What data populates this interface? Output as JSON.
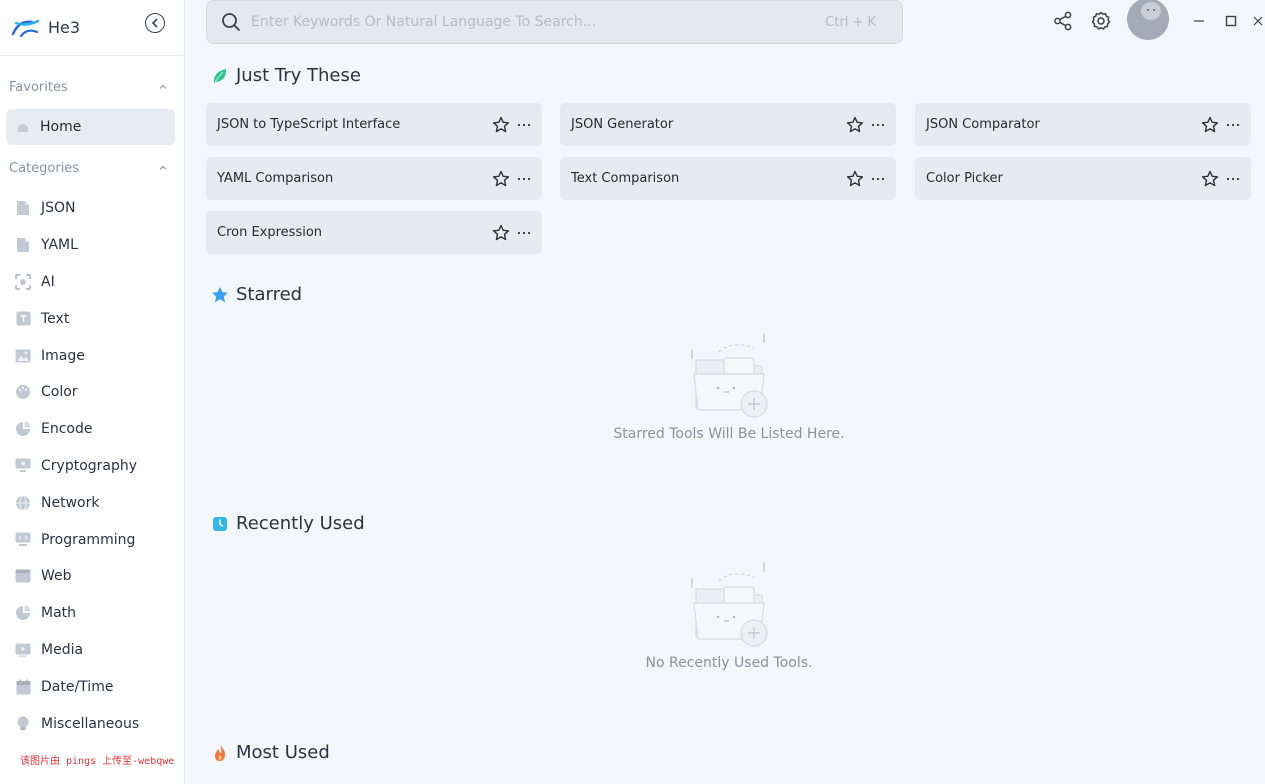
{
  "app": {
    "name": "He3"
  },
  "sidebar": {
    "favorites_label": "Favorites",
    "home_label": "Home",
    "categories_label": "Categories",
    "categories": [
      {
        "label": "JSON",
        "icon": "json-file-icon"
      },
      {
        "label": "YAML",
        "icon": "yaml-file-icon"
      },
      {
        "label": "AI",
        "icon": "ai-icon"
      },
      {
        "label": "Text",
        "icon": "text-icon"
      },
      {
        "label": "Image",
        "icon": "image-icon"
      },
      {
        "label": "Color",
        "icon": "palette-icon"
      },
      {
        "label": "Encode",
        "icon": "encode-icon"
      },
      {
        "label": "Cryptography",
        "icon": "cryptography-icon"
      },
      {
        "label": "Network",
        "icon": "globe-icon"
      },
      {
        "label": "Programming",
        "icon": "code-icon"
      },
      {
        "label": "Web",
        "icon": "browser-icon"
      },
      {
        "label": "Math",
        "icon": "math-icon"
      },
      {
        "label": "Media",
        "icon": "media-icon"
      },
      {
        "label": "Date/Time",
        "icon": "calendar-icon"
      },
      {
        "label": "Miscellaneous",
        "icon": "bulb-icon"
      }
    ],
    "watermark": "该图片由 pings 上传至-webqwe"
  },
  "search": {
    "placeholder": "Enter Keywords Or Natural Language To Search...",
    "shortcut": "Ctrl + K"
  },
  "sections": {
    "just_try": {
      "title": "Just Try These",
      "tools": [
        "JSON to TypeScript Interface",
        "JSON Generator",
        "JSON Comparator",
        "YAML Comparison",
        "Text Comparison",
        "Color Picker",
        "Cron Expression"
      ]
    },
    "starred": {
      "title": "Starred",
      "empty_text": "Starred Tools Will Be Listed Here."
    },
    "recent": {
      "title": "Recently Used",
      "empty_text": "No Recently Used Tools."
    },
    "most_used": {
      "title": "Most Used"
    }
  },
  "colors": {
    "leaf_accent": "#2ec68f",
    "star_accent": "#3aa0f0",
    "clock_accent": "#34b6e8",
    "flame_accent": "#f07a3c"
  }
}
